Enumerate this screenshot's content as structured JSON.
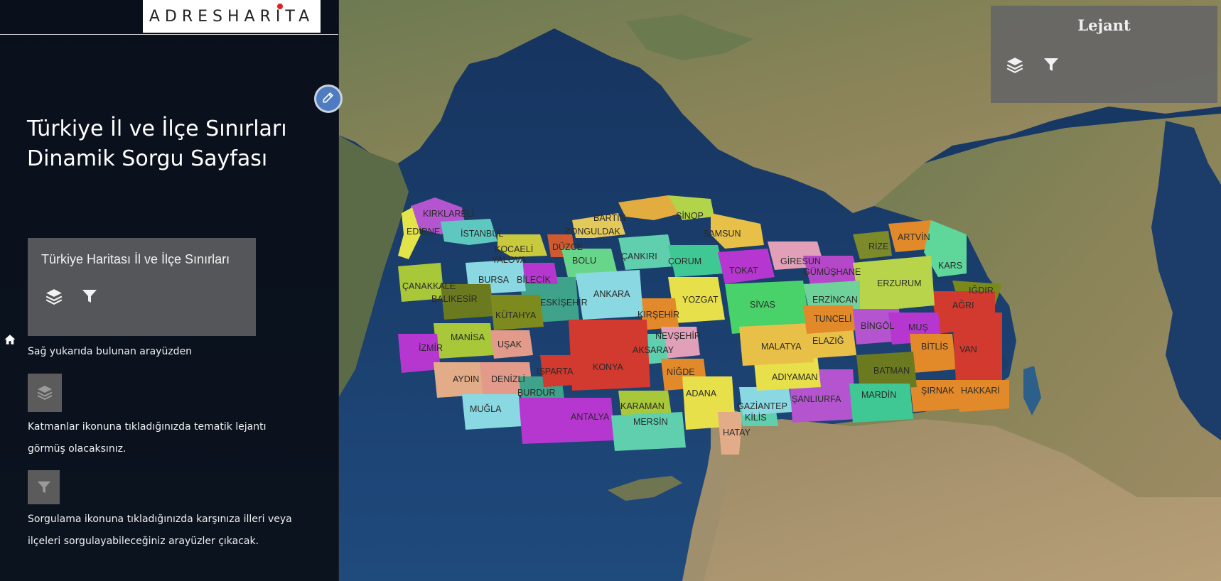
{
  "logo": {
    "text": "ADRESHARITA"
  },
  "sidebar": {
    "title": "Türkiye İl ve İlçe Sınırları\nDinamik Sorgu Sayfası",
    "layer_card_title": "Türkiye Haritası İl ve İlçe Sınırları",
    "instruction_1": "Sağ yukarıda bulunan arayüzden",
    "instruction_2": "Katmanlar ikonuna tıkladığınızda tematik lejantı görmüş olacaksınız.",
    "instruction_3": "Sorgulama ikonuna tıkladığınızda karşınıza illeri veya ilçeleri sorgulayabileceğiniz arayüzler çıkacak."
  },
  "legend": {
    "title": "Lejant"
  },
  "icons": {
    "edit": "pencil-icon",
    "home": "home-icon",
    "layers": "layers-icon",
    "filter": "filter-icon"
  },
  "colors": {
    "sidebar_bg": "#0a0c12",
    "panel_gray": "#666666",
    "edit_button": "#4f7cc0",
    "logo_dot": "#e02020",
    "sea": "#1d3f6e",
    "land": "#6f7a4a"
  },
  "map": {
    "provinces": [
      "KIRKLARELİ",
      "EDİRNE",
      "İSTANBUL",
      "KOCAELİ",
      "YALOVA",
      "DÜZCE",
      "ZONGULDAK",
      "BARTIN",
      "SİNOP",
      "SAMSUN",
      "BOLU",
      "ÇANKIRI",
      "ÇORUM",
      "TOKAT",
      "GİRESUN",
      "GÜMÜŞHANE",
      "RİZE",
      "ARTVİN",
      "KARS",
      "IĞDIR",
      "AĞRI",
      "ERZURUM",
      "ERZİNCAN",
      "SİVAS",
      "YOZGAT",
      "KIRŞEHİR",
      "NEVŞEHİR",
      "AKSARAY",
      "ANKARA",
      "ESKİŞEHİR",
      "BİLECİK",
      "BURSA",
      "ÇANAKKALE",
      "BALIKESİR",
      "KÜTAHYA",
      "MANİSA",
      "İZMİR",
      "UŞAK",
      "AYDIN",
      "DENİZLİ",
      "MUĞLA",
      "BURDUR",
      "ISPARTA",
      "KONYA",
      "ANTALYA",
      "KARAMAN",
      "MERSİN",
      "NİĞDE",
      "ADANA",
      "HATAY",
      "KİLİS",
      "GAZİANTEP",
      "ŞANLIURFA",
      "ADIYAMAN",
      "MALATYA",
      "ELAZIĞ",
      "TUNCELİ",
      "BİNGÖL",
      "MUŞ",
      "BİTLİS",
      "VAN",
      "HAKKARİ",
      "ŞIRNAK",
      "BATMAN",
      "MARDİN"
    ]
  }
}
